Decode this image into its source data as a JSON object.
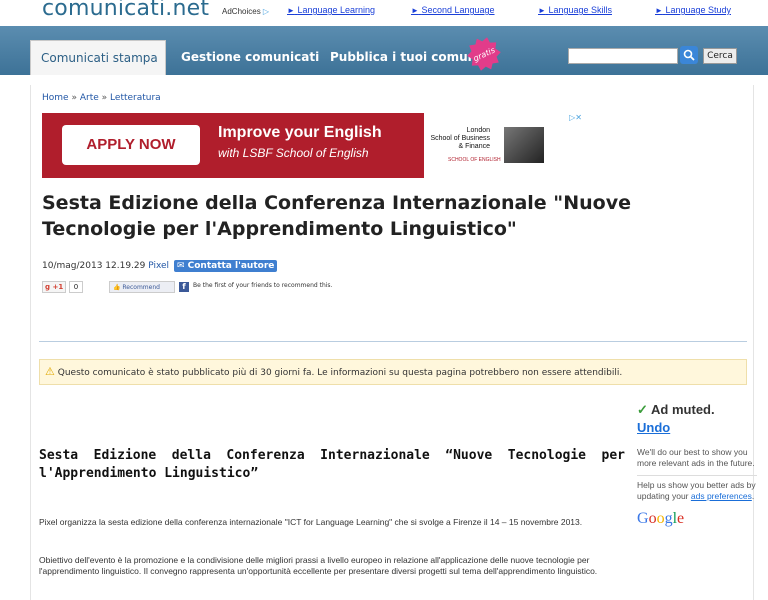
{
  "site": {
    "logo": "comunicati.net"
  },
  "top_ads": {
    "adchoices": "AdChoices",
    "adchoices_glyph": "▷",
    "links": [
      "Language Learning",
      "Second Language",
      "Language Skills",
      "Language Study"
    ],
    "arrow": "►"
  },
  "nav": {
    "tabs": [
      "Comunicati stampa",
      "Gestione comunicati",
      "Pubblica i tuoi comunicati"
    ],
    "badge": "gratis",
    "search_placeholder": "",
    "search_button": "Cerca"
  },
  "breadcrumb": [
    "Home",
    "Arte",
    "Letteratura"
  ],
  "breadcrumb_sep": "»",
  "banner": {
    "apply": "APPLY NOW",
    "headline": "Improve your English",
    "subline": "with LSBF School of English",
    "lsbf_line1": "London",
    "lsbf_line2": "School of Business",
    "lsbf_line3": "& Finance",
    "lsbf_school": "SCHOOL OF ENGLISH",
    "close": "▷✕"
  },
  "article": {
    "title": "Sesta Edizione della Conferenza Internazionale \"Nuove Tecnologie per l'Apprendimento Linguistico\"",
    "date": "10/mag/2013 12.19.29",
    "author": "Pixel",
    "contact": "Contatta l'autore",
    "gplus": "+1",
    "gcount": "0",
    "fb_recommend": "Recommend",
    "fb_text": "Be the first of your friends to recommend this.",
    "warning": "Questo comunicato è stato pubblicato più di 30 giorni fa. Le informazioni su questa pagina potrebbero non essere attendibili.",
    "subtitle": "Sesta Edizione della Conferenza Internazionale “Nuove Tecnologie per l'Apprendimento Linguistico”",
    "p1": "Pixel organizza la sesta edizione della conferenza internazionale \"ICT for Language Learning\" che si svolge a Firenze il 14 – 15 novembre 2013.",
    "p2": "Obiettivo dell'evento è la promozione e la condivisione delle migliori prassi a livello europeo in relazione all'applicazione delle nuove tecnologie per l'apprendimento linguistico. Il convegno rappresenta un'opportunità eccellente per presentare diversi progetti sul tema dell'apprendimento linguistico."
  },
  "ad_muted": {
    "title": "Ad muted.",
    "undo": "Undo",
    "text1": "We'll do our best to show you more relevant ads in the future.",
    "text2_pre": "Help us show you better ads by updating your ",
    "text2_link": "ads preferences",
    "text2_post": ".",
    "google": "Google"
  }
}
